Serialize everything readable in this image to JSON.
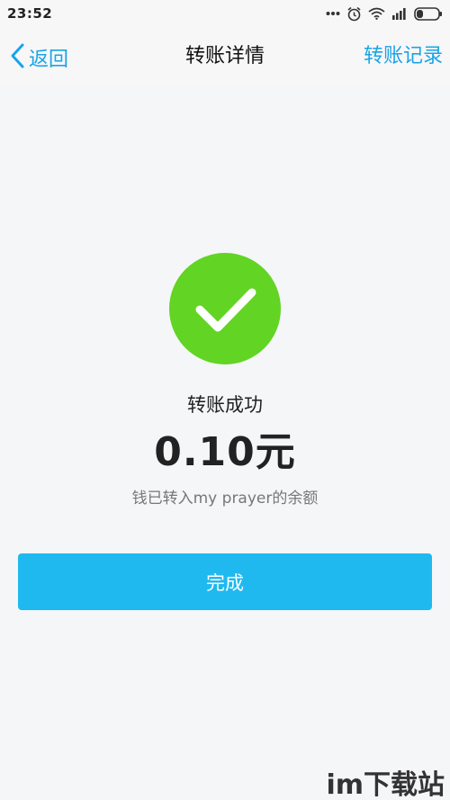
{
  "status_bar": {
    "time": "23:52",
    "icons": [
      "more-dots-icon",
      "alarm-icon",
      "wifi-icon",
      "signal-icon",
      "battery-icon"
    ]
  },
  "nav": {
    "back_label": "返回",
    "title": "转账详情",
    "right_label": "转账记录"
  },
  "result": {
    "icon": "check-circle-icon",
    "title": "转账成功",
    "amount": "0.10元",
    "description": "钱已转入my prayer的余额"
  },
  "actions": {
    "done_label": "完成"
  },
  "watermark": {
    "text": "im下载站"
  },
  "colors": {
    "accent": "#1aa3e8",
    "button": "#1fb9f0",
    "success": "#62d424",
    "background": "#f5f6f8"
  }
}
